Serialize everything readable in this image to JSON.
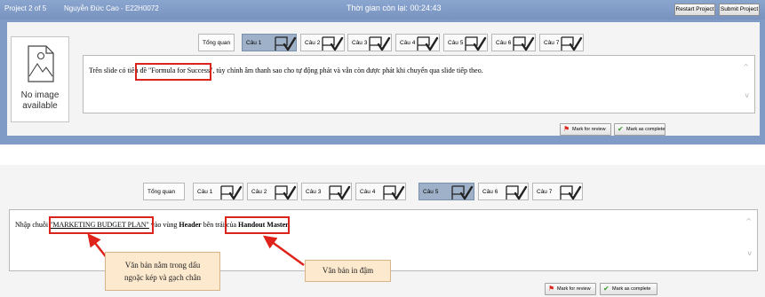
{
  "titlebar": {
    "project": "Project 2 of 5",
    "user": "Nguyễn Đức Cao - E22H0072",
    "timer": "Thời gian còn lại: 00:24:43",
    "restart_label": "Restart Project",
    "submit_label": "Submit Project"
  },
  "no_image": {
    "line1": "No image",
    "line2": "available"
  },
  "tabs": {
    "overview": "Tổng quan",
    "q1": "Câu 1",
    "q2": "Câu 2",
    "q3": "Câu 3",
    "q4": "Câu 4",
    "q5": "Câu 5",
    "q6": "Câu 6",
    "q7": "Câu 7"
  },
  "task1": {
    "before": "Trên slide có tiêu đề ",
    "quoted": "\"Formula for Success\"",
    "after": ", tùy chỉnh âm thanh sao cho tự động phát và vẫn còn được phát khi chuyển qua slide tiếp theo."
  },
  "task2": {
    "before": "Nhập chuỗi ",
    "quoted": "\"MARKETING BUDGET PLAN\"",
    "mid1": " vào vùng ",
    "bold1": "Header",
    "mid2": " bên trái của ",
    "bold2": "Handout Master",
    "end": "."
  },
  "buttons": {
    "mark_review": "Mark for review",
    "mark_complete": "Mark as complete"
  },
  "annotations": {
    "callout1_line1": "Văn bản nằm trong dấu",
    "callout1_line2": "ngoặc kép và gạch chân",
    "callout2": "Văn bản in đậm"
  },
  "colors": {
    "header_bg": "#7f9bc6",
    "active_tab": "#9fb1c8",
    "highlight": "#d9251b",
    "callout_bg": "#fde9ce"
  }
}
